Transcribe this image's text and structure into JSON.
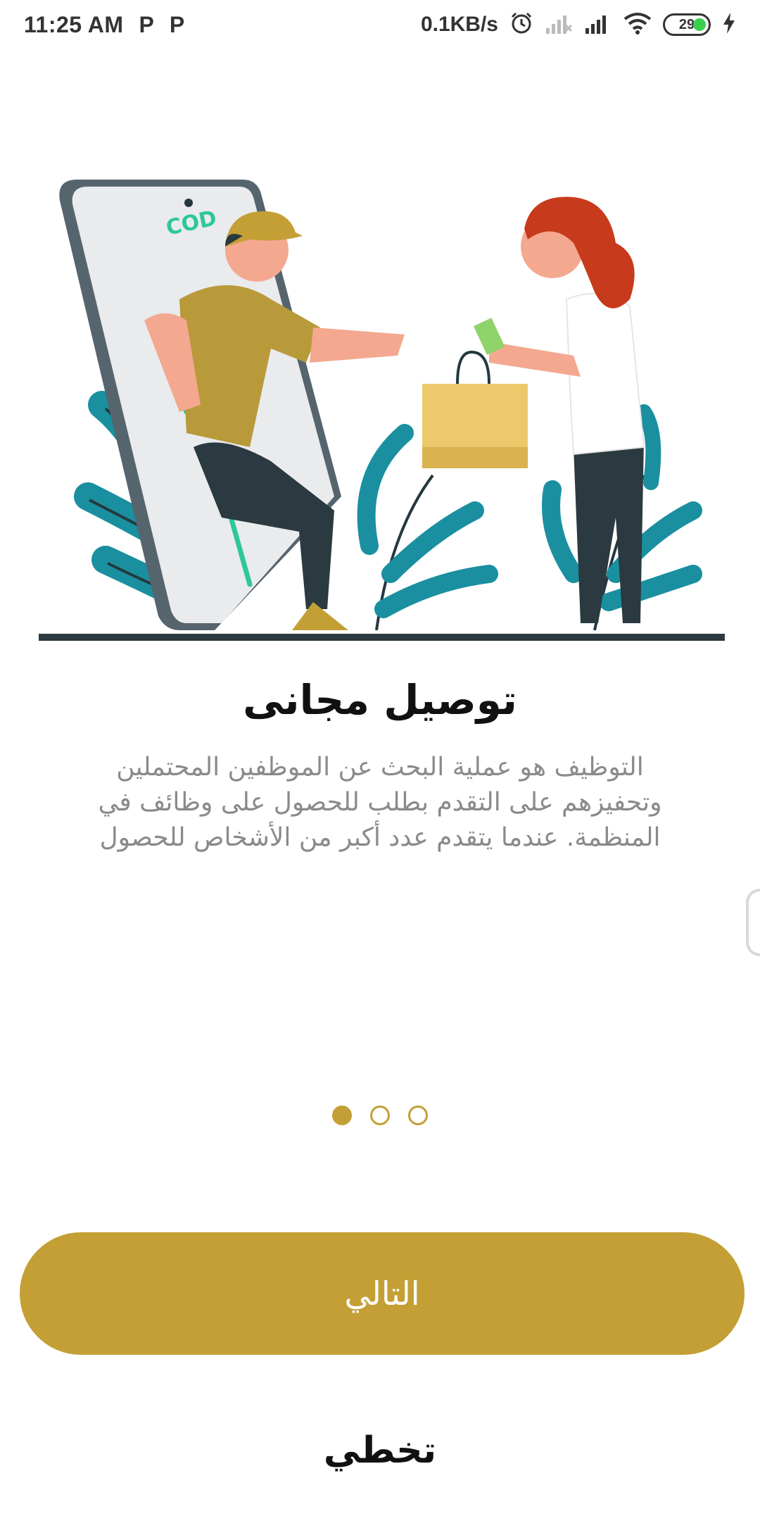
{
  "status_bar": {
    "time": "11:25 AM",
    "notification_icons": [
      "P",
      "P"
    ],
    "net_speed": "0.1KB/s",
    "battery_level": "29",
    "icons": [
      "alarm-icon",
      "signal-off-icon",
      "signal-icon",
      "wifi-icon",
      "battery-icon",
      "charging-icon"
    ]
  },
  "illustration": {
    "phone_label": "COD"
  },
  "onboarding": {
    "title": "توصيل مجانى",
    "description": "التوظيف هو عملية البحث عن الموظفين المحتملين وتحفيزهم على التقدم بطلب للحصول على وظائف في المنظمة. عندما يتقدم عدد أكبر من الأشخاص للحصول",
    "page_indicator": {
      "current": 1,
      "total": 3
    }
  },
  "actions": {
    "next_label": "التالي",
    "skip_label": "تخطي"
  },
  "colors": {
    "accent": "#c49f35",
    "teal": "#1a8fa0",
    "description_text": "#8a8a8a"
  }
}
